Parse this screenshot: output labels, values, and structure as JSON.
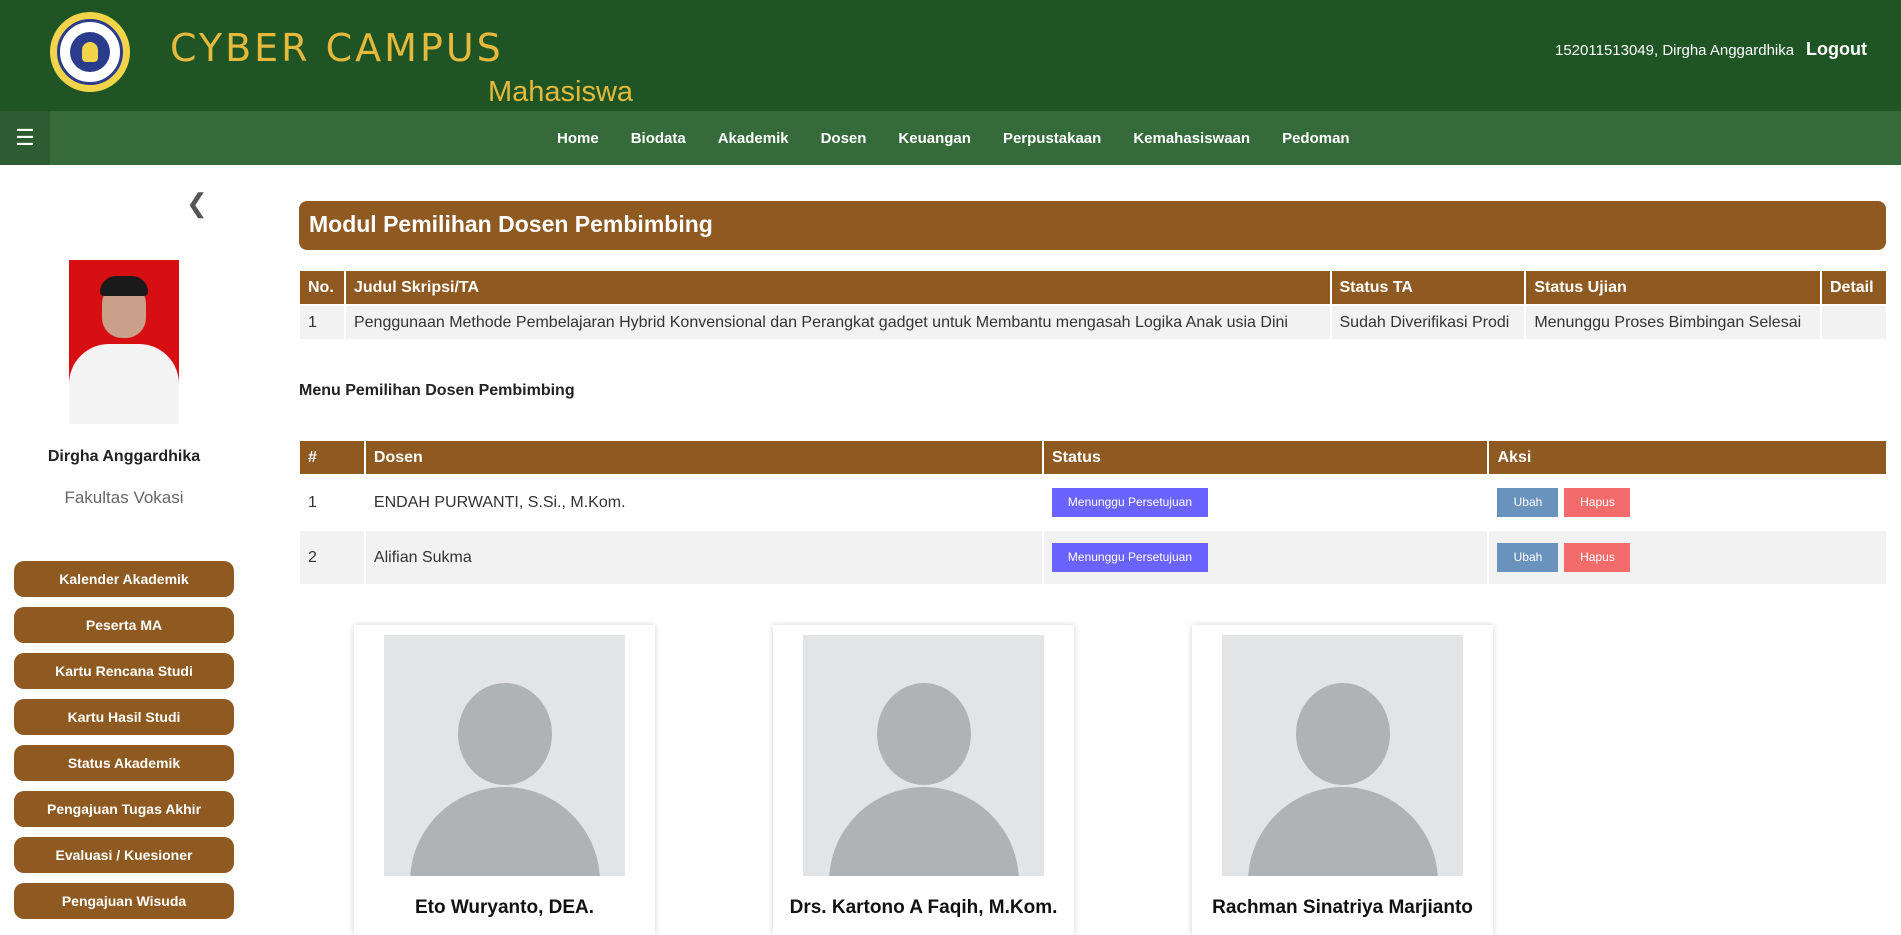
{
  "header": {
    "brand_title": "CYBER CAMPUS",
    "brand_subtitle": "Mahasiswa",
    "user_info": "152011513049, Dirgha Anggardhika",
    "logout": "Logout"
  },
  "nav": {
    "menu_icon": "☰",
    "items": [
      "Home",
      "Biodata",
      "Akademik",
      "Dosen",
      "Keuangan",
      "Perpustakaan",
      "Kemahasiswaan",
      "Pedoman"
    ]
  },
  "sidebar": {
    "collapse_icon": "❮",
    "student_name": "Dirgha Anggardhika",
    "faculty": "Fakultas Vokasi",
    "menu": [
      "Kalender Akademik",
      "Peserta MA",
      "Kartu Rencana Studi",
      "Kartu Hasil Studi",
      "Status Akademik",
      "Pengajuan Tugas Akhir",
      "Evaluasi / Kuesioner",
      "Pengajuan Wisuda"
    ]
  },
  "main": {
    "module_title": "Modul Pemilihan Dosen Pembimbing",
    "ta_table": {
      "headers": [
        "No.",
        "Judul Skripsi/TA",
        "Status TA",
        "Status Ujian",
        "Detail"
      ],
      "rows": [
        [
          "1",
          "Penggunaan Methode Pembelajaran Hybrid Konvensional dan Perangkat gadget untuk Membantu mengasah Logika Anak usia Dini",
          "Sudah Diverifikasi Prodi",
          "Menunggu Proses Bimbingan Selesai",
          ""
        ]
      ]
    },
    "section_label": "Menu Pemilihan Dosen Pembimbing",
    "dosen_table": {
      "headers": [
        "#",
        "Dosen",
        "Status",
        "Aksi"
      ],
      "rows": [
        {
          "no": "1",
          "dosen": "ENDAH PURWANTI, S.Si., M.Kom.",
          "status": "Menunggu Persetujuan",
          "ubah": "Ubah",
          "hapus": "Hapus"
        },
        {
          "no": "2",
          "dosen": "Alifian Sukma",
          "status": "Menunggu Persetujuan",
          "ubah": "Ubah",
          "hapus": "Hapus"
        }
      ]
    },
    "cards": [
      {
        "name": "Eto Wuryanto, DEA."
      },
      {
        "name": "Drs. Kartono A Faqih, M.Kom."
      },
      {
        "name": "Rachman Sinatriya Marjianto"
      }
    ]
  },
  "colors": {
    "header_bg": "#1f5424",
    "navbar_bg": "#356b3a",
    "accent_brown": "#8f5a21",
    "brand_gold": "#e6b93c",
    "status_purple": "#6a63ff",
    "ubah_blue": "#6992bd",
    "hapus_red": "#f36b6b"
  }
}
